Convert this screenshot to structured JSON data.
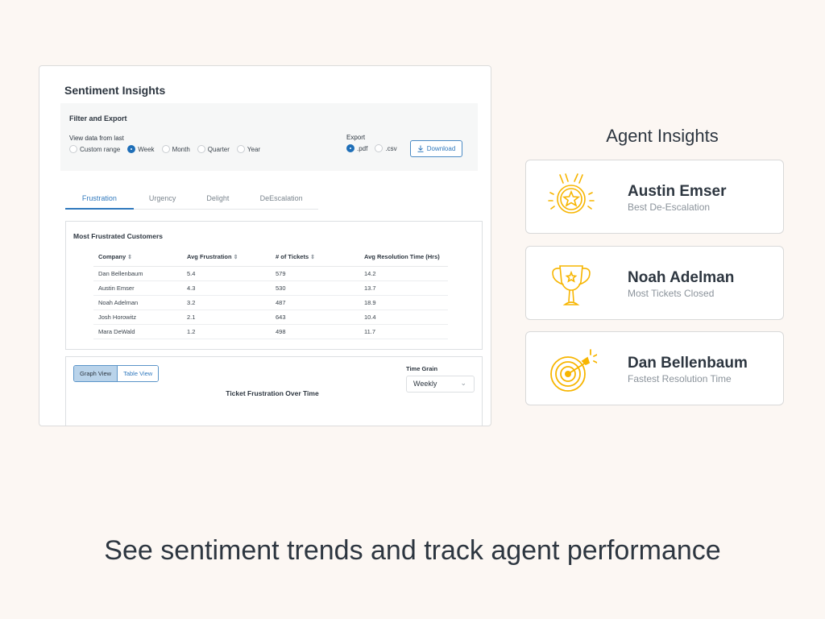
{
  "panel": {
    "title": "Sentiment Insights",
    "filter": {
      "title": "Filter and Export",
      "view_label": "View data from last",
      "ranges": [
        {
          "label": "Custom range",
          "selected": false
        },
        {
          "label": "Week",
          "selected": true
        },
        {
          "label": "Month",
          "selected": false
        },
        {
          "label": "Quarter",
          "selected": false
        },
        {
          "label": "Year",
          "selected": false
        }
      ],
      "export_label": "Export",
      "formats": [
        {
          "label": ".pdf",
          "selected": true
        },
        {
          "label": ".csv",
          "selected": false
        }
      ],
      "download_label": "Download"
    },
    "tabs": [
      {
        "label": "Frustration",
        "active": true
      },
      {
        "label": "Urgency",
        "active": false
      },
      {
        "label": "Delight",
        "active": false
      },
      {
        "label": "DeEscalation",
        "active": false
      }
    ],
    "table": {
      "title": "Most Frustrated Customers",
      "columns": [
        "Company",
        "Avg Frustration",
        "# of Tickets",
        "Avg Resolution Time (Hrs)"
      ],
      "rows": [
        [
          "Dan Bellenbaum",
          "5.4",
          "579",
          "14.2"
        ],
        [
          "Austin Emser",
          "4.3",
          "530",
          "13.7"
        ],
        [
          "Noah Adelman",
          "3.2",
          "487",
          "18.9"
        ],
        [
          "Josh Horowitz",
          "2.1",
          "643",
          "10.4"
        ],
        [
          "Mara DeWald",
          "1.2",
          "498",
          "11.7"
        ]
      ]
    },
    "graph": {
      "view_options": [
        "Graph View",
        "Table View"
      ],
      "active_view": "Graph View",
      "title": "Ticket Frustration Over Time",
      "time_grain_label": "Time Grain",
      "time_grain_value": "Weekly"
    }
  },
  "agents": {
    "heading": "Agent Insights",
    "cards": [
      {
        "name": "Austin Emser",
        "award": "Best De-Escalation",
        "icon": "medal-icon"
      },
      {
        "name": "Noah Adelman",
        "award": "Most Tickets Closed",
        "icon": "trophy-icon"
      },
      {
        "name": "Dan Bellenbaum",
        "award": "Fastest Resolution Time",
        "icon": "target-icon"
      }
    ]
  },
  "tagline": "See sentiment trends and track agent performance",
  "colors": {
    "accent": "#2f78bd",
    "award_gold": "#f7b500",
    "background": "#fcf7f3"
  }
}
